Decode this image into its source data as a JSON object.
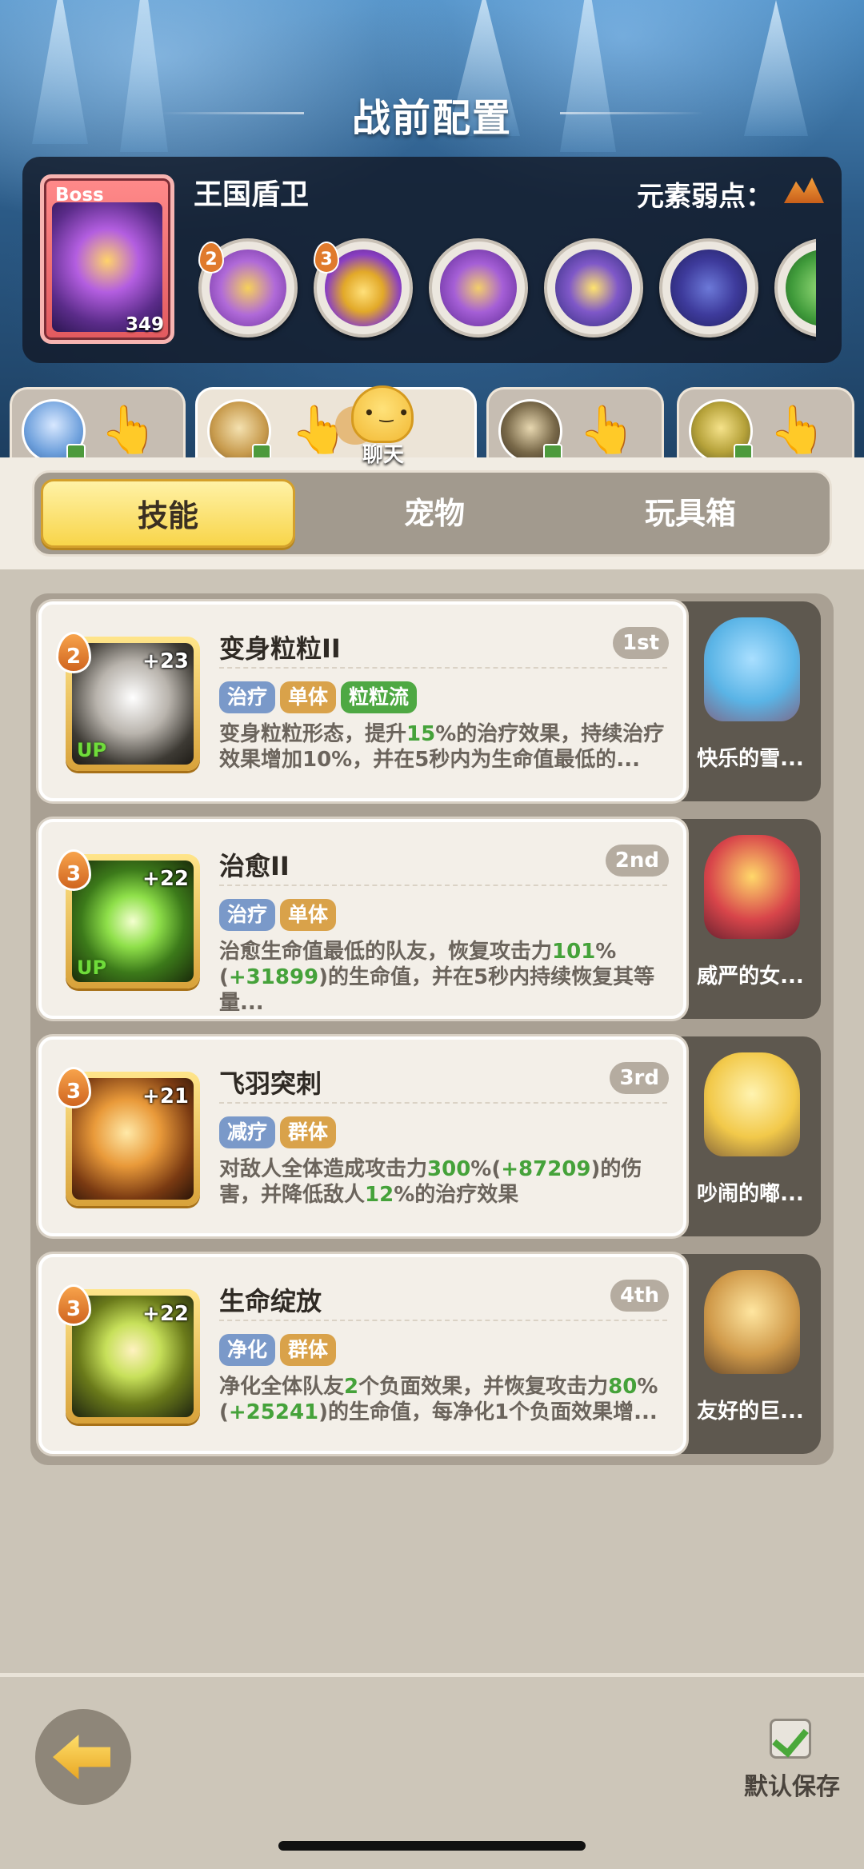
{
  "header": {
    "title": "战前配置",
    "boss": {
      "tag": "Boss",
      "name": "王国盾卫",
      "level": "349"
    },
    "weakness_label": "元素弱点：",
    "boss_skills": [
      {
        "badge": "2",
        "icon": "golden-claw-skill-icon"
      },
      {
        "badge": "3",
        "icon": "golden-crown-skill-icon"
      },
      {
        "badge": "",
        "icon": "shield-crest-skill-icon"
      },
      {
        "badge": "",
        "icon": "winged-helm-skill-icon"
      },
      {
        "badge": "",
        "icon": "shadow-beast-skill-icon"
      }
    ]
  },
  "party_tabs": [
    {
      "name": "party-slot-1",
      "active": false
    },
    {
      "name": "party-slot-2",
      "active": true
    },
    {
      "name": "party-slot-3",
      "active": false
    },
    {
      "name": "party-slot-4",
      "active": false
    }
  ],
  "chat": {
    "label": "聊天"
  },
  "tabs": {
    "skills": "技能",
    "pets": "宠物",
    "toybox": "玩具箱"
  },
  "skills": [
    {
      "cost": "2",
      "count": "+23",
      "up": "UP",
      "title": "变身粒粒II",
      "rank": "1st",
      "tags": [
        {
          "text": "治疗",
          "color": "blue"
        },
        {
          "text": "单体",
          "color": "yellow"
        },
        {
          "text": "粒粒流",
          "color": "green"
        }
      ],
      "desc_parts": [
        "变身粒粒形态，提升",
        "15",
        "%的治疗效果，持续治疗效果增加10%，并在5秒内为生命值最低的..."
      ],
      "pet_name": "快乐的雪..."
    },
    {
      "cost": "3",
      "count": "+22",
      "up": "UP",
      "title": "治愈II",
      "rank": "2nd",
      "tags": [
        {
          "text": "治疗",
          "color": "blue"
        },
        {
          "text": "单体",
          "color": "yellow"
        }
      ],
      "desc_parts": [
        "治愈生命值最低的队友，恢复攻击力",
        "101",
        "%(",
        "+31899",
        ")的生命值，并在5秒内持续恢复其等量..."
      ],
      "pet_name": "威严的女..."
    },
    {
      "cost": "3",
      "count": "+21",
      "up": "",
      "title": "飞羽突刺",
      "rank": "3rd",
      "tags": [
        {
          "text": "减疗",
          "color": "blue"
        },
        {
          "text": "群体",
          "color": "yellow"
        }
      ],
      "desc_parts": [
        "对敌人全体造成攻击力",
        "300",
        "%(",
        "+87209",
        ")的伤害，并降低敌人",
        "12",
        "%的治疗效果"
      ],
      "pet_name": "吵闹的嘟..."
    },
    {
      "cost": "3",
      "count": "+22",
      "up": "",
      "title": "生命绽放",
      "rank": "4th",
      "tags": [
        {
          "text": "净化",
          "color": "blue"
        },
        {
          "text": "群体",
          "color": "yellow"
        }
      ],
      "desc_parts": [
        "净化全体队友",
        "2",
        "个负面效果，并恢复攻击力",
        "80",
        "%(",
        "+25241",
        ")的生命值，每净化1个负面效果增..."
      ],
      "pet_name": "友好的巨..."
    }
  ],
  "footer": {
    "save_label": "默认保存"
  },
  "colors": {
    "accent_yellow": "#f8d54a",
    "highlight_green": "#45a23a",
    "boss_red": "#e25a5f"
  }
}
